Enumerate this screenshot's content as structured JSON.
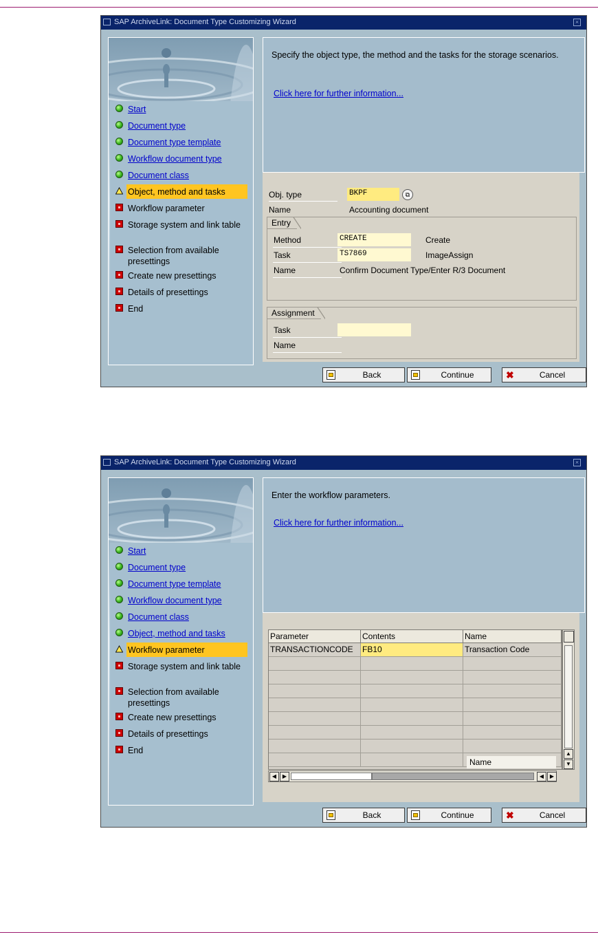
{
  "window_title": "SAP ArchiveLink: Document Type Customizing Wizard",
  "steps": [
    "Start",
    "Document type",
    "Document type template",
    "Workflow document type",
    "Document class",
    "Object, method and tasks",
    "Workflow parameter",
    "Storage system and link table",
    "Selection from available presettings",
    "Create new presettings",
    "Details of presettings",
    "End"
  ],
  "buttons": {
    "back": "Back",
    "continue": "Continue",
    "cancel": "Cancel"
  },
  "link_text": "Click here for further information...",
  "screen1": {
    "current_step": 5,
    "info_text": "Specify the object type, the method and the tasks for the storage scenarios.",
    "obj_type_label": "Obj. type",
    "obj_type_value": "BKPF",
    "name_label": "Name",
    "name_value": "Accounting document",
    "entry": {
      "title": "Entry",
      "method_label": "Method",
      "method_value": "CREATE",
      "method_desc": "Create",
      "task_label": "Task",
      "task_value": "TS7869",
      "task_desc": "ImageAssign",
      "name_label": "Name",
      "name_value": "Confirm Document Type/Enter R/3 Document"
    },
    "assignment": {
      "title": "Assignment",
      "task_label": "Task",
      "task_value": "",
      "name_label": "Name"
    }
  },
  "screen2": {
    "current_step": 6,
    "info_text": "Enter the workflow parameters.",
    "table": {
      "columns": [
        "Parameter",
        "Contents",
        "Name"
      ],
      "rows": [
        [
          "TRANSACTIONCODE",
          "FB10",
          "Transaction Code"
        ]
      ],
      "tooltip": "Name"
    }
  },
  "colors": {
    "highlight": "#ffc521",
    "title_bar": "#0a246a",
    "link": "#0000cc",
    "frame": "#9b1a6f"
  }
}
